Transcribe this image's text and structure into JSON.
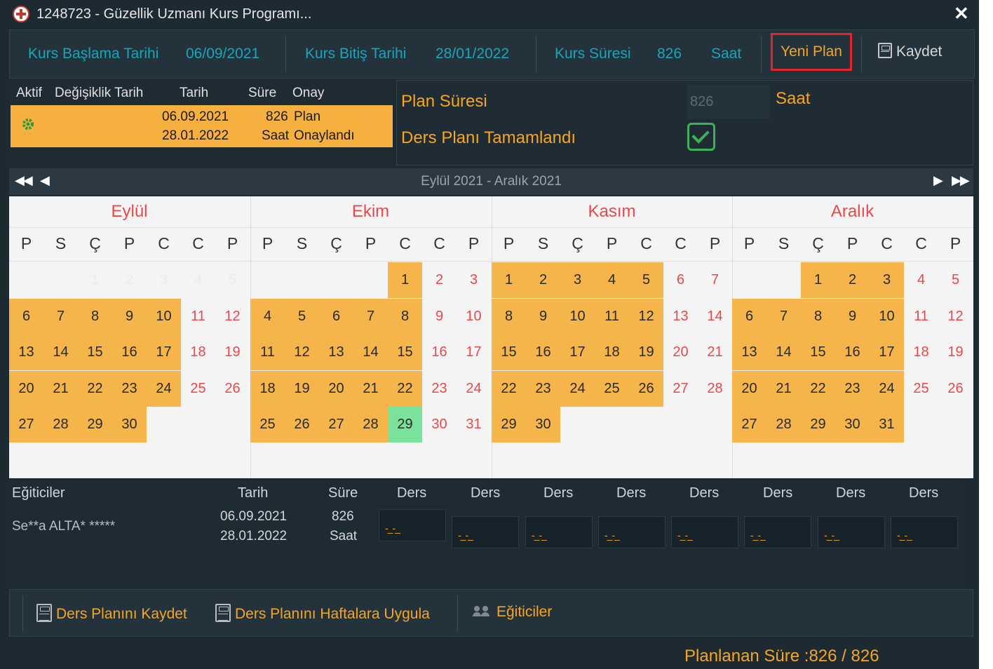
{
  "window": {
    "title": "1248723 - Güzellik Uzmanı Kurs Programı..."
  },
  "info": {
    "start_label": "Kurs Başlama Tarihi",
    "start_value": "06/09/2021",
    "end_label": "Kurs Bitiş Tarihi",
    "end_value": "28/01/2022",
    "duration_label": "Kurs Süresi",
    "duration_value": "826",
    "duration_unit": "Saat",
    "new_plan": "Yeni Plan",
    "save": "Kaydet"
  },
  "plan_table": {
    "headers": [
      "Aktif",
      "Değişiklik Tarih",
      "Tarih",
      "Süre",
      "Onay"
    ],
    "row": {
      "date1": "06.09.2021",
      "date2": "28.01.2022",
      "dur1": "826",
      "dur2": "Saat",
      "status1": "Plan",
      "status2": "Onaylandı"
    }
  },
  "plan_info": {
    "duration_label": "Plan Süresi",
    "duration_value": "826",
    "unit": "Saat",
    "completed_label": "Ders Planı Tamamlandı",
    "completed": true
  },
  "calendar": {
    "range_label": "Eylül 2021 - Aralık 2021",
    "weekdays": [
      "P",
      "S",
      "Ç",
      "P",
      "C",
      "C",
      "P"
    ],
    "colors": {
      "planned": "#f5b54a",
      "weekend": "#e8484a",
      "today": "#7ae29a"
    },
    "months": [
      {
        "name": "Eylül",
        "offset": 2,
        "days": 30,
        "planned_days": [
          6,
          7,
          8,
          9,
          10,
          13,
          14,
          15,
          16,
          17,
          20,
          21,
          22,
          23,
          24,
          27,
          28,
          29,
          30
        ],
        "highlight_day": null,
        "faded": true
      },
      {
        "name": "Ekim",
        "offset": 4,
        "days": 31,
        "planned_days": [
          1,
          4,
          5,
          6,
          7,
          8,
          11,
          12,
          13,
          14,
          15,
          18,
          19,
          20,
          21,
          22,
          25,
          26,
          27,
          28
        ],
        "highlight_day": 29,
        "faded": false
      },
      {
        "name": "Kasım",
        "offset": 0,
        "days": 30,
        "planned_days": [
          1,
          2,
          3,
          4,
          5,
          8,
          9,
          10,
          11,
          12,
          15,
          16,
          17,
          18,
          19,
          22,
          23,
          24,
          25,
          26,
          29,
          30
        ],
        "highlight_day": null,
        "faded": false
      },
      {
        "name": "Aralık",
        "offset": 2,
        "days": 31,
        "planned_days": [
          1,
          2,
          3,
          6,
          7,
          8,
          9,
          10,
          13,
          14,
          15,
          16,
          17,
          20,
          21,
          22,
          23,
          24,
          27,
          28,
          29,
          30,
          31
        ],
        "highlight_day": null,
        "faded": false
      }
    ]
  },
  "trainers": {
    "headers": {
      "name": "Eğiticiler",
      "date": "Tarih",
      "duration": "Süre",
      "lesson": "Ders"
    },
    "rows": [
      {
        "name": "Se**a ALTA* *****",
        "date1": "06.09.2021",
        "date2": "28.01.2022",
        "dur1": "826",
        "dur2": "Saat"
      }
    ],
    "lesson_placeholder": "-_-_"
  },
  "bottom": {
    "save_plan": "Ders Planını Kaydet",
    "apply_weeks": "Ders Planını Haftalara Uygula",
    "trainers": "Eğiticiler"
  },
  "footer": {
    "planned": "Planlanan Süre :826 / 826"
  }
}
